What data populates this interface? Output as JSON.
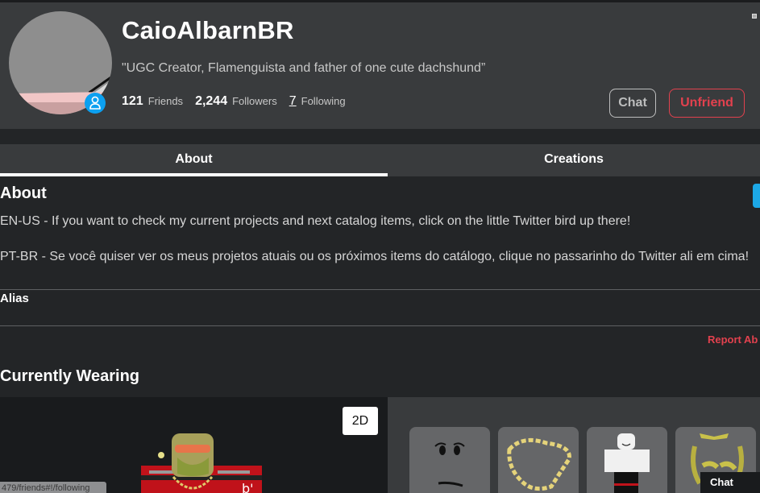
{
  "profile": {
    "username": "CaioAlbarnBR",
    "status": "\"UGC Creator, Flamenguista and father of one cute dachshund”",
    "stats": {
      "friends_count": "121",
      "friends_label": "Friends",
      "followers_count": "2,244",
      "followers_label": "Followers",
      "following_count": "7",
      "following_label": "Following"
    },
    "presence_icon": "user-icon",
    "buttons": {
      "chat": "Chat",
      "unfriend": "Unfriend"
    }
  },
  "tabs": [
    {
      "label": "About",
      "active": true
    },
    {
      "label": "Creations",
      "active": false
    }
  ],
  "about": {
    "title": "About",
    "description": [
      "EN-US - If you want to check my current projects and next catalog items, click on the little Twitter bird up there!",
      "",
      "PT-BR - Se você quiser ver os meus projetos atuais ou os próximos items do catálogo, clique no passarinho do Twitter ali em cima!"
    ],
    "alias_label": "Alias",
    "report_label": "Report Ab"
  },
  "currently_wearing": {
    "title": "Currently Wearing",
    "toggle_2d_label": "2D",
    "items": [
      {
        "name": "angry-face-item"
      },
      {
        "name": "gold-chain-item"
      },
      {
        "name": "white-shirt-item"
      },
      {
        "name": "gold-beard-item"
      }
    ]
  },
  "status_bar": {
    "url": "479/friends#!/following"
  },
  "chat_dock": {
    "label": "Chat"
  },
  "colors": {
    "accent_red": "#e2414e",
    "presence_blue": "#0ca0f0",
    "header_bg": "#393b3d",
    "page_bg": "#232527"
  }
}
